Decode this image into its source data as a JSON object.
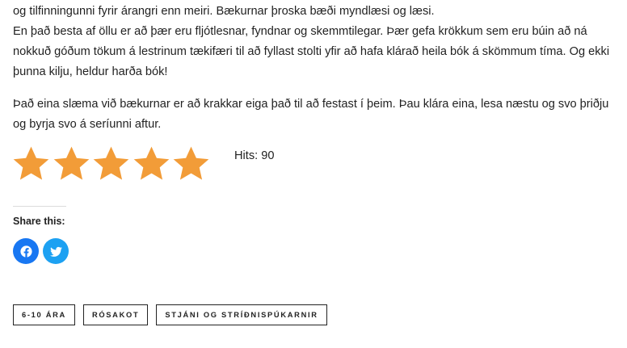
{
  "article": {
    "line1": "og tilfinningunni fyrir árangri enn meiri. Bækurnar þroska bæði myndlæsi og læsi.",
    "paragraph2": "En það besta af öllu er að þær eru fljótlesnar, fyndnar og skemmtilegar. Þær gefa krökkum sem eru búin að ná nokkuð góðum tökum á lestrinum tækifæri til að fyllast stolti yfir að hafa klárað heila bók á skömmum tíma. Og ekki þunna kilju, heldur harða bók!",
    "paragraph3": "Það eina slæma við bækurnar er að krakkar eiga það til að festast í þeim. Þau klára eina, lesa næstu og svo þriðju og byrja svo á seríunni aftur."
  },
  "rating": {
    "value": 5,
    "max": 5,
    "star_color": "#f29c38"
  },
  "hits": {
    "text": "Hits: 90"
  },
  "share": {
    "title": "Share this:",
    "buttons": [
      {
        "icon": "facebook-icon",
        "color": "#1877f2"
      },
      {
        "icon": "twitter-icon",
        "color": "#1da1f2"
      }
    ]
  },
  "tags": [
    "6-10 ÁRA",
    "RÓSAKOT",
    "STJÁNI OG STRÍÐNISPÚKARNIR"
  ]
}
